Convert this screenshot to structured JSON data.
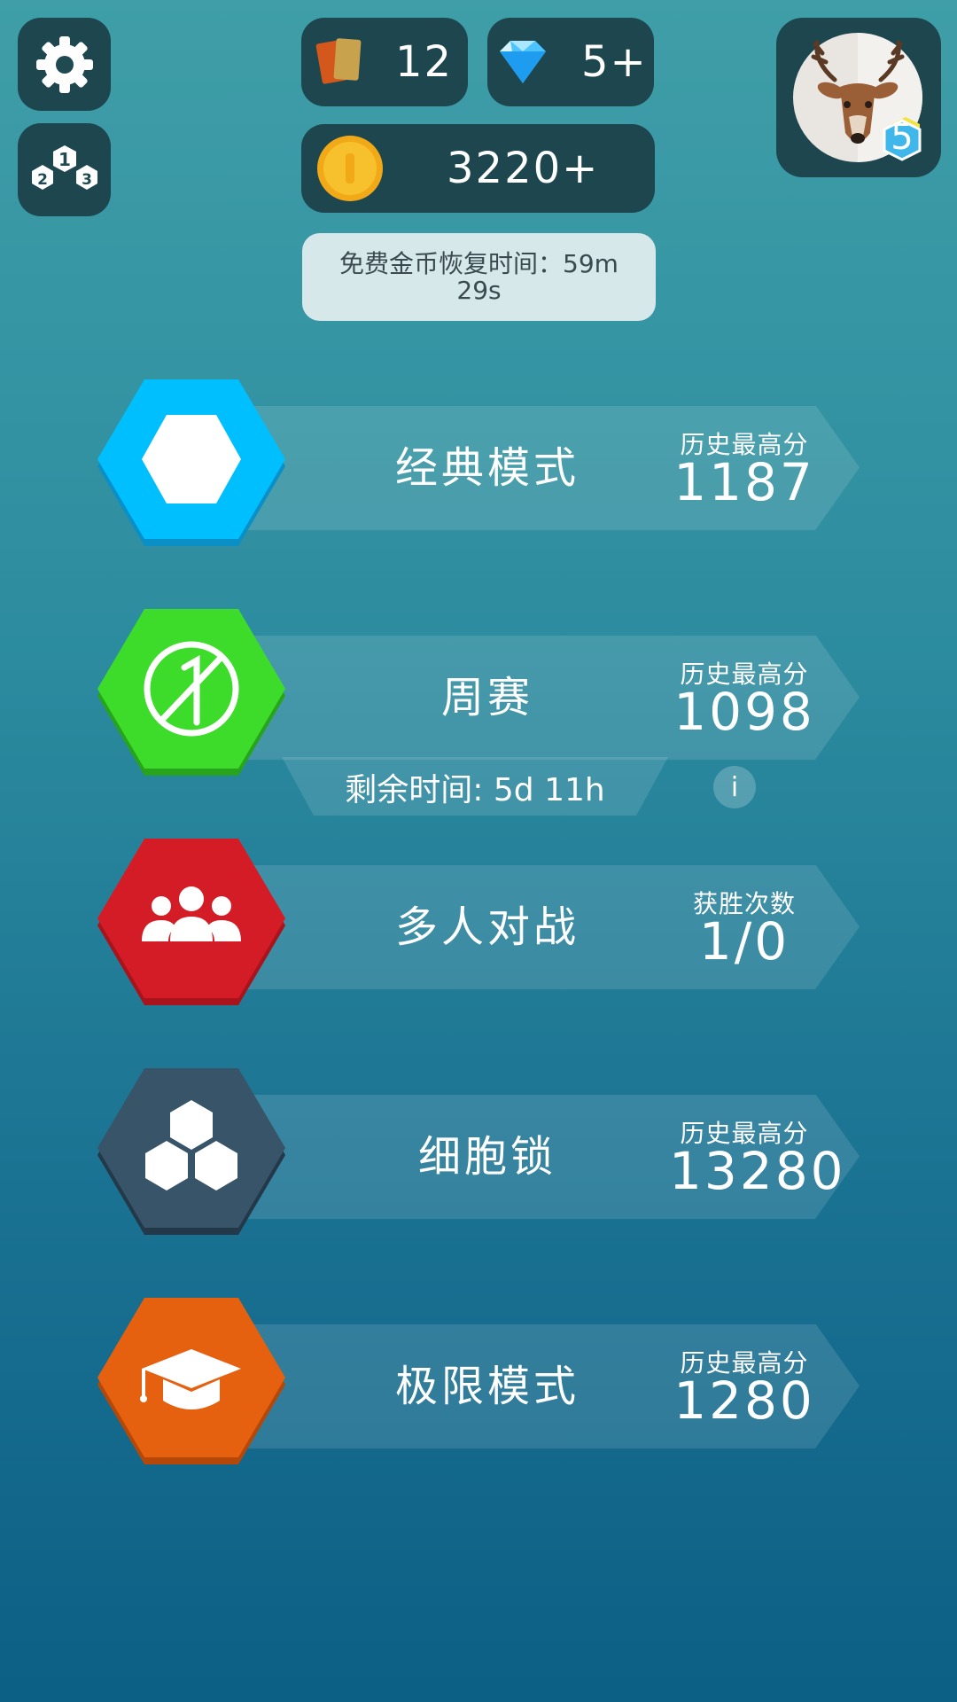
{
  "top_bar": {
    "cards_count": "12",
    "gems_count": "5+",
    "coins_count": "3220+",
    "coin_timer_line1": "免费金币恢复时间：59m",
    "coin_timer_line2": "29s",
    "player_level": "5"
  },
  "modes": [
    {
      "title": "经典模式",
      "stat_label": "历史最高分",
      "stat_value": "1187",
      "color": "#00bfff",
      "icon": "hexagon-icon"
    },
    {
      "title": "周赛",
      "stat_label": "历史最高分",
      "stat_value": "1098",
      "color": "#3ddc2a",
      "icon": "no-one-icon"
    },
    {
      "title": "多人对战",
      "stat_label": "获胜次数",
      "stat_value": "1/0",
      "color": "#d41c27",
      "icon": "group-icon"
    },
    {
      "title": "细胞锁",
      "stat_label": "历史最高分",
      "stat_value": "13280",
      "color": "#385468",
      "icon": "cells-icon"
    },
    {
      "title": "极限模式",
      "stat_label": "历史最高分",
      "stat_value": "1280",
      "color": "#e5600f",
      "icon": "graduation-cap-icon"
    }
  ],
  "weekly": {
    "remaining": "剩余时间: 5d 11h",
    "info": "i"
  }
}
